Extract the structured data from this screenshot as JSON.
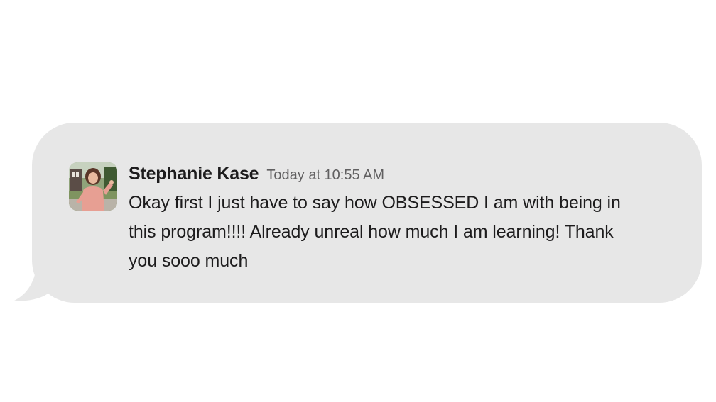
{
  "message": {
    "author": "Stephanie Kase",
    "timestamp": "Today at 10:55 AM",
    "lines": [
      "Okay first I just have to say how OBSESSED I am with being in",
      "this program!!!! Already unreal how much I am learning! Thank",
      "you sooo much"
    ]
  },
  "avatar": {
    "icon": "user-photo-avatar"
  },
  "colors": {
    "bubble": "#e7e7e7",
    "author_text": "#1d1c1d",
    "timestamp_text": "#616061",
    "page_background": "#ffffff"
  }
}
